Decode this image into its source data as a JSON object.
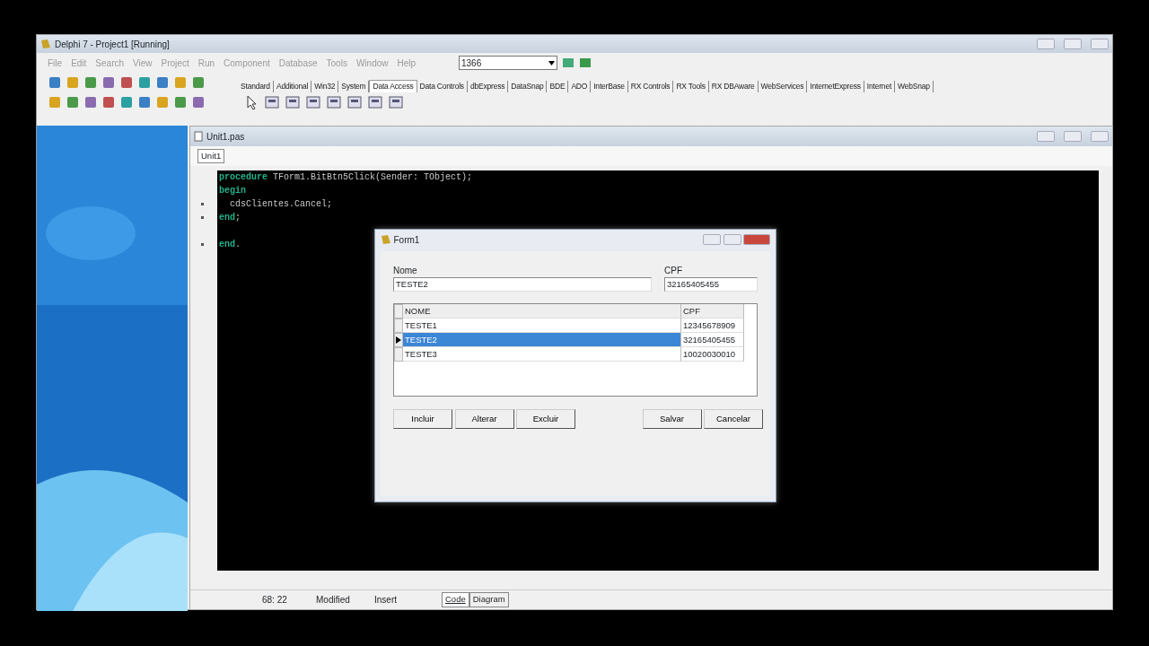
{
  "window": {
    "title": "Delphi 7 - Project1 [Running]"
  },
  "menu": {
    "disabled": true,
    "items": [
      "File",
      "Edit",
      "Search",
      "View",
      "Project",
      "Run",
      "Component",
      "Database",
      "Tools",
      "Window",
      "Help"
    ]
  },
  "desktop_combo": {
    "value": "1366"
  },
  "palette_tabs": [
    {
      "label": "Standard",
      "selected": false
    },
    {
      "label": "Additional",
      "selected": false
    },
    {
      "label": "Win32",
      "selected": false
    },
    {
      "label": "System",
      "selected": false
    },
    {
      "label": "Data Access",
      "selected": true
    },
    {
      "label": "Data Controls",
      "selected": false
    },
    {
      "label": "dbExpress",
      "selected": false
    },
    {
      "label": "DataSnap",
      "selected": false
    },
    {
      "label": "BDE",
      "selected": false
    },
    {
      "label": "ADO",
      "selected": false
    },
    {
      "label": "InterBase",
      "selected": false
    },
    {
      "label": "RX Controls",
      "selected": false
    },
    {
      "label": "RX Tools",
      "selected": false
    },
    {
      "label": "RX DBAware",
      "selected": false
    },
    {
      "label": "WebServices",
      "selected": false
    },
    {
      "label": "InternetExpress",
      "selected": false
    },
    {
      "label": "Internet",
      "selected": false
    },
    {
      "label": "WebSnap",
      "selected": false
    }
  ],
  "editor": {
    "title": "Unit1.pas",
    "tab": "Unit1",
    "lines": [
      {
        "keyword": "procedure",
        "text": " TForm1.BitBtn5Click(Sender: TObject);",
        "marked": false
      },
      {
        "keyword": "begin",
        "marked": false
      },
      {
        "text": "  cdsClientes.Cancel;",
        "marked": true
      },
      {
        "keyword": "end",
        "text": ";",
        "marked": true
      },
      {
        "marked": false
      },
      {
        "keyword": "end",
        "text": ".",
        "marked": true
      }
    ],
    "status": {
      "position": "68: 22",
      "modified": "Modified",
      "mode": "Insert"
    },
    "view_tabs": [
      {
        "label": "Code",
        "selected": true
      },
      {
        "label": "Diagram",
        "selected": false
      }
    ]
  },
  "form": {
    "title": "Form1",
    "fields": [
      {
        "label": "Nome",
        "value": "TESTE2"
      },
      {
        "label": "CPF",
        "value": "32165405455"
      }
    ],
    "grid": {
      "columns": [
        "NOME",
        "CPF"
      ],
      "rows": [
        {
          "cells": [
            "TESTE1",
            "12345678909"
          ],
          "selected": false
        },
        {
          "cells": [
            "TESTE2",
            "32165405455"
          ],
          "selected": true
        },
        {
          "cells": [
            "TESTE3",
            "10020030010"
          ],
          "selected": false
        }
      ]
    },
    "buttons_left": [
      "Incluir",
      "Alterar",
      "Excluir"
    ],
    "buttons_right": [
      "Salvar",
      "Cancelar"
    ]
  }
}
